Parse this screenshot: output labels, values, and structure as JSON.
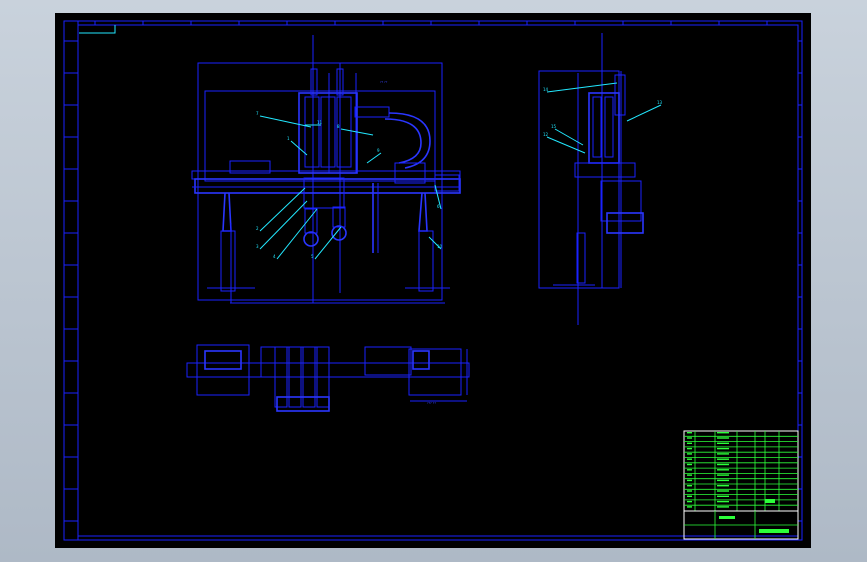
{
  "window": {
    "background": "#000000",
    "line_color": "#1a22ff",
    "leader_color": "#22e8ff",
    "table_color": "#2cff3a"
  },
  "front_view": {
    "callouts": [
      "7",
      "1",
      "8",
      "9",
      "2",
      "3",
      "4",
      "5",
      "6",
      "10",
      "11"
    ],
    "dimension_text": "?? ??"
  },
  "side_view": {
    "callouts": [
      "14",
      "13",
      "12",
      "15"
    ]
  },
  "title_block": {
    "rows": 15
  }
}
